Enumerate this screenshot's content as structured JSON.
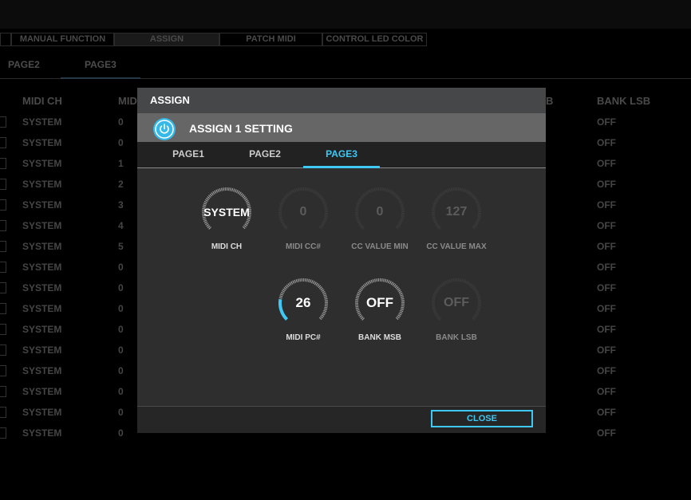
{
  "background": {
    "top_tabs": [
      {
        "label": "MANUAL FUNCTION",
        "active": false
      },
      {
        "label": "ASSIGN",
        "active": true
      },
      {
        "label": "PATCH MIDI",
        "active": false
      },
      {
        "label": "CONTROL LED COLOR",
        "active": false
      }
    ],
    "sub_tabs": [
      {
        "label": "PAGE2",
        "active": false
      },
      {
        "label": "PAGE3",
        "active": true
      }
    ],
    "headers": {
      "midi_ch": "MIDI CH",
      "midi": "MIDI",
      "lsb_partial": "B",
      "bank_lsb": "BANK LSB"
    },
    "rows": [
      {
        "ch": "SYSTEM",
        "cc": "0",
        "lsb": "OFF"
      },
      {
        "ch": "SYSTEM",
        "cc": "0",
        "lsb": "OFF"
      },
      {
        "ch": "SYSTEM",
        "cc": "1",
        "lsb": "OFF"
      },
      {
        "ch": "SYSTEM",
        "cc": "2",
        "lsb": "OFF"
      },
      {
        "ch": "SYSTEM",
        "cc": "3",
        "lsb": "OFF"
      },
      {
        "ch": "SYSTEM",
        "cc": "4",
        "lsb": "OFF"
      },
      {
        "ch": "SYSTEM",
        "cc": "5",
        "lsb": "OFF"
      },
      {
        "ch": "SYSTEM",
        "cc": "0",
        "lsb": "OFF"
      },
      {
        "ch": "SYSTEM",
        "cc": "0",
        "lsb": "OFF"
      },
      {
        "ch": "SYSTEM",
        "cc": "0",
        "lsb": "OFF"
      },
      {
        "ch": "SYSTEM",
        "cc": "0",
        "lsb": "OFF"
      },
      {
        "ch": "SYSTEM",
        "cc": "0",
        "lsb": "OFF"
      },
      {
        "ch": "SYSTEM",
        "cc": "0",
        "lsb": "OFF"
      },
      {
        "ch": "SYSTEM",
        "cc": "0",
        "lsb": "OFF"
      },
      {
        "ch": "SYSTEM",
        "cc": "0",
        "lsb": "OFF"
      },
      {
        "ch": "SYSTEM",
        "cc": "0",
        "lsb": "OFF"
      }
    ]
  },
  "dialog": {
    "title": "ASSIGN",
    "subtitle": "ASSIGN 1 SETTING",
    "power_icon": "power-icon",
    "tabs": [
      {
        "label": "PAGE1",
        "active": false
      },
      {
        "label": "PAGE2",
        "active": false
      },
      {
        "label": "PAGE3",
        "active": true
      }
    ],
    "knobs": [
      {
        "key": "midi_ch",
        "value": "SYSTEM",
        "label": "MIDI CH",
        "enabled": true,
        "level": 0
      },
      {
        "key": "midi_cc",
        "value": "0",
        "label": "MIDI CC#",
        "enabled": false,
        "level": 0
      },
      {
        "key": "cc_value_min",
        "value": "0",
        "label": "CC VALUE MIN",
        "enabled": false,
        "level": 0
      },
      {
        "key": "cc_value_max",
        "value": "127",
        "label": "CC VALUE MAX",
        "enabled": false,
        "level": 0
      },
      {
        "key": "midi_pc",
        "value": "26",
        "label": "MIDI PC#",
        "enabled": true,
        "level": 0.2
      },
      {
        "key": "bank_msb",
        "value": "OFF",
        "label": "BANK MSB",
        "enabled": true,
        "level": 0
      },
      {
        "key": "bank_lsb",
        "value": "OFF",
        "label": "BANK LSB",
        "enabled": false,
        "level": 0
      }
    ],
    "close_label": "CLOSE",
    "accent_color": "#3fc8f4"
  }
}
